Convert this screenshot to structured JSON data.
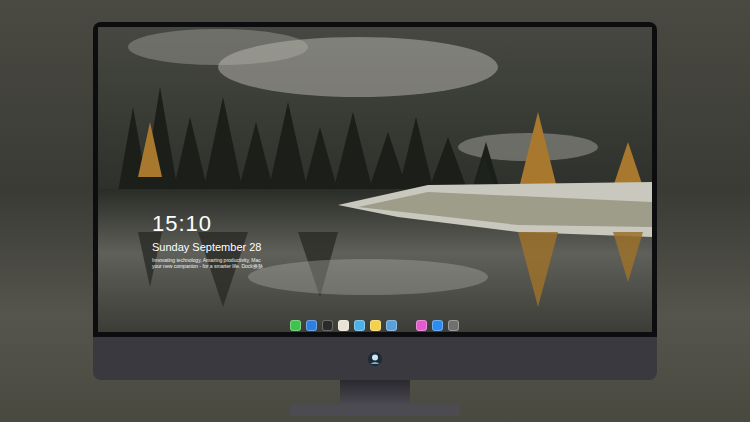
{
  "lock_screen": {
    "time": "15:10",
    "date": "Sunday September 28",
    "tagline": [
      "Innovating technology, Amazing productivity, Mac",
      "your new companion - for a smarter life. Dock换肤"
    ]
  },
  "dock": {
    "items": [
      {
        "color": "#3fc24e"
      },
      {
        "color": "#2f7fe0"
      },
      {
        "color": "#2a2a2a"
      },
      {
        "color": "#e8e3d5"
      },
      {
        "color": "#4fb0e8"
      },
      {
        "color": "#f5d04a"
      },
      {
        "color": "#5aa0d8"
      },
      {
        "color": "#e45bd0"
      },
      {
        "color": "#2d8cf0"
      },
      {
        "color": "#707070"
      }
    ]
  }
}
